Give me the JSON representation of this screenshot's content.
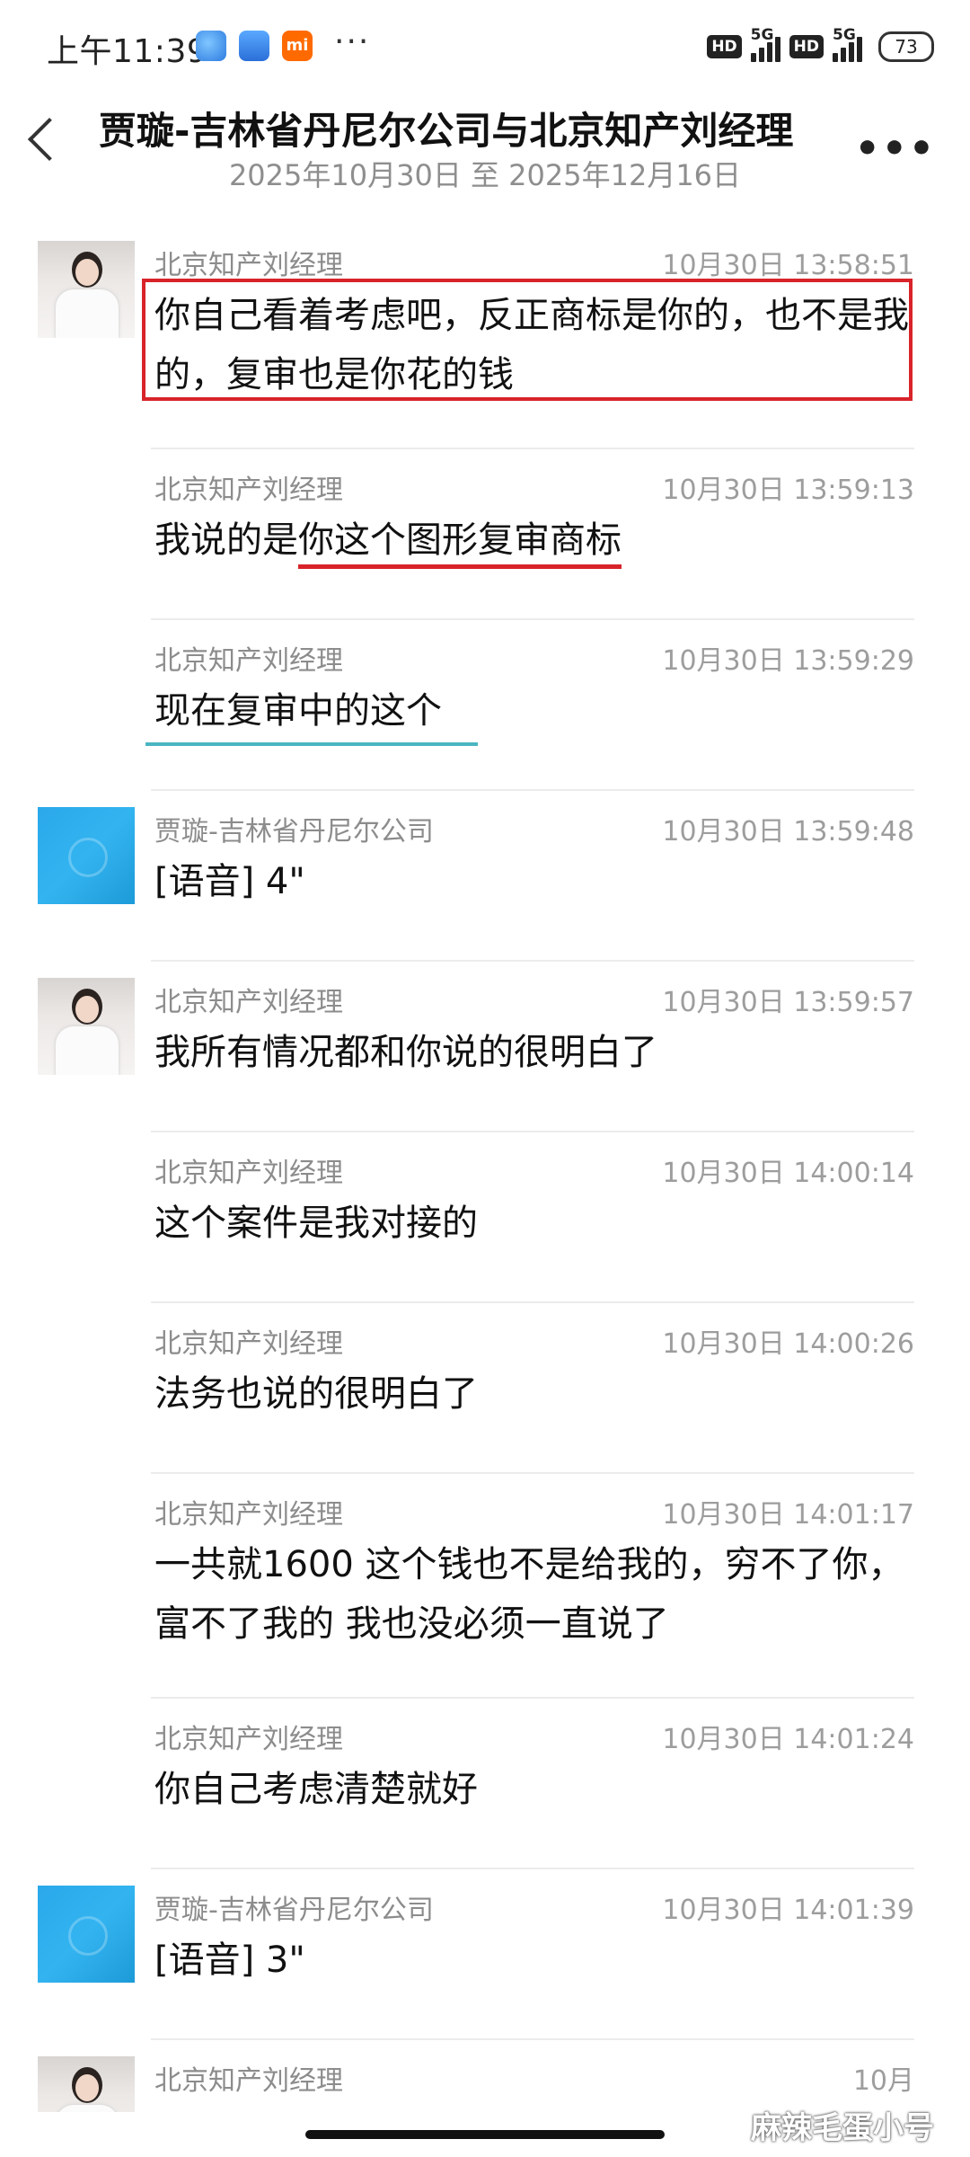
{
  "status_bar": {
    "time": "上午11:39",
    "app_icon_label": "mi",
    "more": "···",
    "hd1": "HD",
    "hd2": "HD",
    "net1": "5G",
    "net2": "5G",
    "battery": "73"
  },
  "header": {
    "title": "贾璇-吉林省丹尼尔公司与北京知产刘经理",
    "subtitle": "2025年10月30日 至 2025年12月16日"
  },
  "messages": [
    {
      "sender": "北京知产刘经理",
      "time": "10月30日 13:58:51",
      "text": "你自己看着考虑吧，反正商标是你的，也不是我的，复审也是你花的钱"
    },
    {
      "sender": "北京知产刘经理",
      "time": "10月30日 13:59:13",
      "text_prefix": "我说的是",
      "text_highlight": "你这个图形复审商标"
    },
    {
      "sender": "北京知产刘经理",
      "time": "10月30日 13:59:29",
      "text": "现在复审中的这个"
    },
    {
      "sender": "贾璇-吉林省丹尼尔公司",
      "time": "10月30日 13:59:48",
      "text": "[语音] 4\""
    },
    {
      "sender": "北京知产刘经理",
      "time": "10月30日 13:59:57",
      "text": "我所有情况都和你说的很明白了"
    },
    {
      "sender": "北京知产刘经理",
      "time": "10月30日 14:00:14",
      "text": "这个案件是我对接的"
    },
    {
      "sender": "北京知产刘经理",
      "time": "10月30日 14:00:26",
      "text": "法务也说的很明白了"
    },
    {
      "sender": "北京知产刘经理",
      "time": "10月30日 14:01:17",
      "text": "一共就1600   这个钱也不是给我的，穷不了你，富不了我的 我也没必须一直说了"
    },
    {
      "sender": "北京知产刘经理",
      "time": "10月30日 14:01:24",
      "text": "你自己考虑清楚就好"
    },
    {
      "sender": "贾璇-吉林省丹尼尔公司",
      "time": "10月30日 14:01:39",
      "text": "[语音] 3\""
    },
    {
      "sender": "北京知产刘经理",
      "time": "10月"
    }
  ],
  "watermark": "麻辣毛蛋小号",
  "colors": {
    "highlight_red": "#d8232a",
    "underline_teal": "#4bb5c1",
    "meta_gray": "#9d9d9d"
  }
}
